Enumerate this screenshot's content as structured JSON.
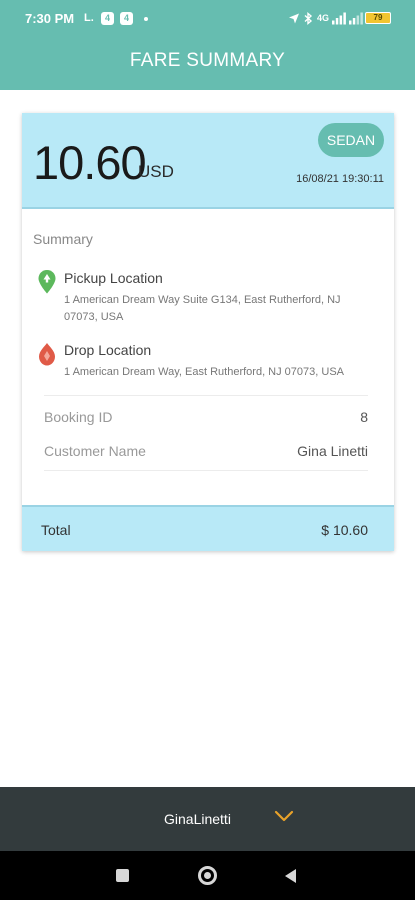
{
  "status_bar": {
    "time": "7:30 PM",
    "notif_icons": [
      "L.",
      "4",
      "4"
    ],
    "signal_text": "4G",
    "battery_text": "79"
  },
  "header": {
    "title": "FARE SUMMARY"
  },
  "fare": {
    "amount": "10.60",
    "currency": "USD",
    "car_type": "SEDAN",
    "datetime": "16/08/21 19:30:11"
  },
  "summary": {
    "label": "Summary",
    "pickup": {
      "title": "Pickup Location",
      "address": "1 American Dream Way Suite G134, East Rutherford, NJ 07073, USA"
    },
    "drop": {
      "title": "Drop Location",
      "address": "1 American Dream Way, East Rutherford, NJ 07073, USA"
    },
    "booking_id": {
      "label": "Booking ID",
      "value": "8"
    },
    "customer_name": {
      "label": "Customer Name",
      "value": "Gina Linetti"
    }
  },
  "total": {
    "label": "Total",
    "value": "$ 10.60"
  },
  "user_bar": {
    "name": "GinaLinetti"
  },
  "colors": {
    "accent": "#66bdb0",
    "card_highlight": "#b8e9f7",
    "pickup_pin": "#5cb85c",
    "drop_pin": "#e05a47",
    "chevron": "#e8a22a"
  },
  "icons": {
    "pickup": "pickup-pin-icon",
    "drop": "drop-pin-icon",
    "expand": "chevron-down-icon"
  }
}
